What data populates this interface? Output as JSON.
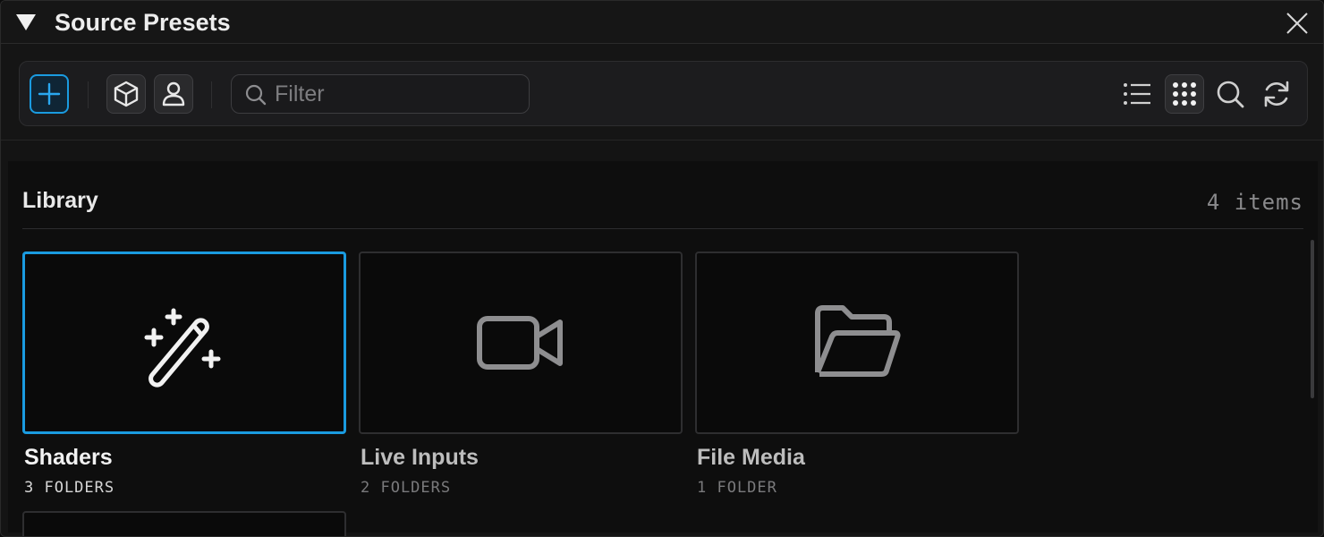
{
  "window": {
    "title": "Source Presets"
  },
  "toolbar": {
    "add_icon": "plus-icon",
    "cube_icon": "cube-icon",
    "user_icon": "user-icon",
    "filter_placeholder": "Filter",
    "filter_value": "",
    "list_view_icon": "list-icon",
    "grid_view_icon": "grid-icon",
    "search_icon": "search-icon",
    "refresh_icon": "refresh-icon",
    "active_view": "grid"
  },
  "library": {
    "title": "Library",
    "count": "4 items",
    "items": [
      {
        "name": "Shaders",
        "meta": "3 FOLDERS",
        "icon": "magic-wand-icon",
        "selected": true
      },
      {
        "name": "Live Inputs",
        "meta": "2 FOLDERS",
        "icon": "video-camera-icon",
        "selected": false
      },
      {
        "name": "File Media",
        "meta": "1 FOLDER",
        "icon": "folder-open-icon",
        "selected": false
      }
    ]
  },
  "colors": {
    "accent": "#1a9be0",
    "background": "#141414",
    "card": "#0a0a0a"
  }
}
